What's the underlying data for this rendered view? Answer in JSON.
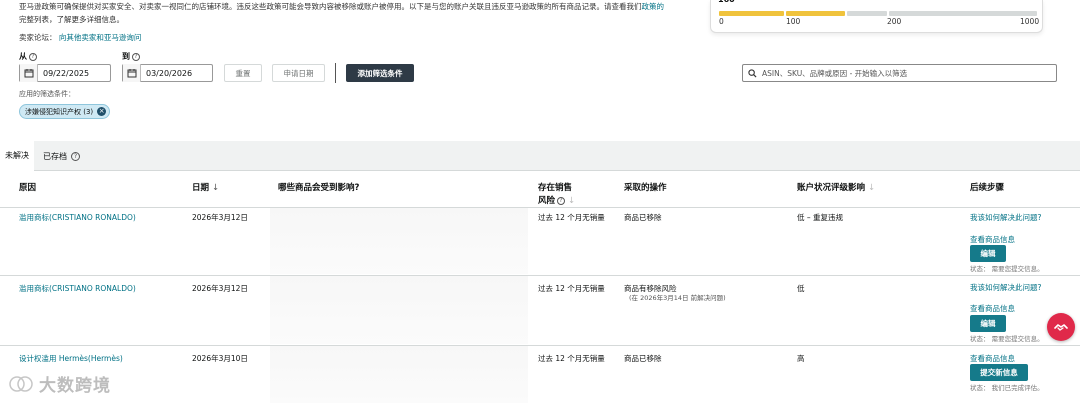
{
  "intro": {
    "line1": "亚马逊政策可确保提供对买家安全、对卖家一视同仁的店铺环境。违反这些政策可能会导致内容被移除或账户被停用。以下是与您的账户关联且违反亚马逊政策的所有商品记录。请查看我们",
    "line1_link": "政策的",
    "line2": "完整列表，了解更多详细信息。",
    "forum_label": "卖家论坛：",
    "forum_link": "向其他卖家和亚马逊询问"
  },
  "score": {
    "value": "160",
    "ticks": [
      "0",
      "100",
      "200",
      "1000"
    ],
    "fill_fraction": 0.16,
    "colors": {
      "fill": "#f0c33c",
      "empty": "#d5d9d9"
    }
  },
  "filters": {
    "from_label": "从",
    "to_label": "到",
    "from_date": "09/22/2025",
    "to_date": "03/20/2026",
    "reset_label": "重置",
    "apply_label": "申请日期",
    "add_filter_label": "添加筛选条件",
    "search_placeholder": "ASIN、SKU、品牌或原因 - 开始输入以筛选",
    "applied_label": "应用的筛选条件：",
    "chip_label": "涉嫌侵犯知识产权 (3)"
  },
  "tabs": [
    {
      "label": "未解决"
    },
    {
      "label": "已存档"
    }
  ],
  "table": {
    "headers": {
      "reason": "原因",
      "date": "日期",
      "affected": "哪些商品会受到影响?",
      "risk_line1": "存在销售",
      "risk_line2": "风险",
      "action": "采取的操作",
      "impact": "账户状况评级影响",
      "next": "后续步骤"
    },
    "rows": [
      {
        "reason": "滥用商标(CRISTIANO RONALDO)",
        "date": "2026年3月12日",
        "risk": "过去 12 个月无销量",
        "action": "商品已移除",
        "action_sub": "",
        "impact": "低 – 重复违规",
        "next_link1": "我该如何解决此问题?",
        "next_link2": "查看商品信息",
        "button": "编辑",
        "status": "状态：  需要您提交信息。"
      },
      {
        "reason": "滥用商标(CRISTIANO RONALDO)",
        "date": "2026年3月12日",
        "risk": "过去 12 个月无销量",
        "action": "商品有移除风险",
        "action_sub": "(在 2026年3月14日 前解决问题)",
        "impact": "低",
        "next_link1": "我该如何解决此问题?",
        "next_link2": "查看商品信息",
        "button": "编辑",
        "status": "状态：  需要您提交信息。"
      },
      {
        "reason": "设计权滥用 Hermès(Hermès)",
        "date": "2026年3月10日",
        "risk": "过去 12 个月无销量",
        "action": "商品已移除",
        "action_sub": "",
        "impact": "高",
        "next_link1": "查看商品信息",
        "next_link2": "",
        "button": "提交新信息",
        "status": "状态：  我们已完成评估。"
      }
    ]
  },
  "watermark": "大数跨境",
  "colors": {
    "link": "#007185",
    "teal_button": "#157a8a",
    "dark_button": "#2e3a46",
    "chip_bg": "#cfe9f4",
    "float_button": "#e0294a"
  }
}
